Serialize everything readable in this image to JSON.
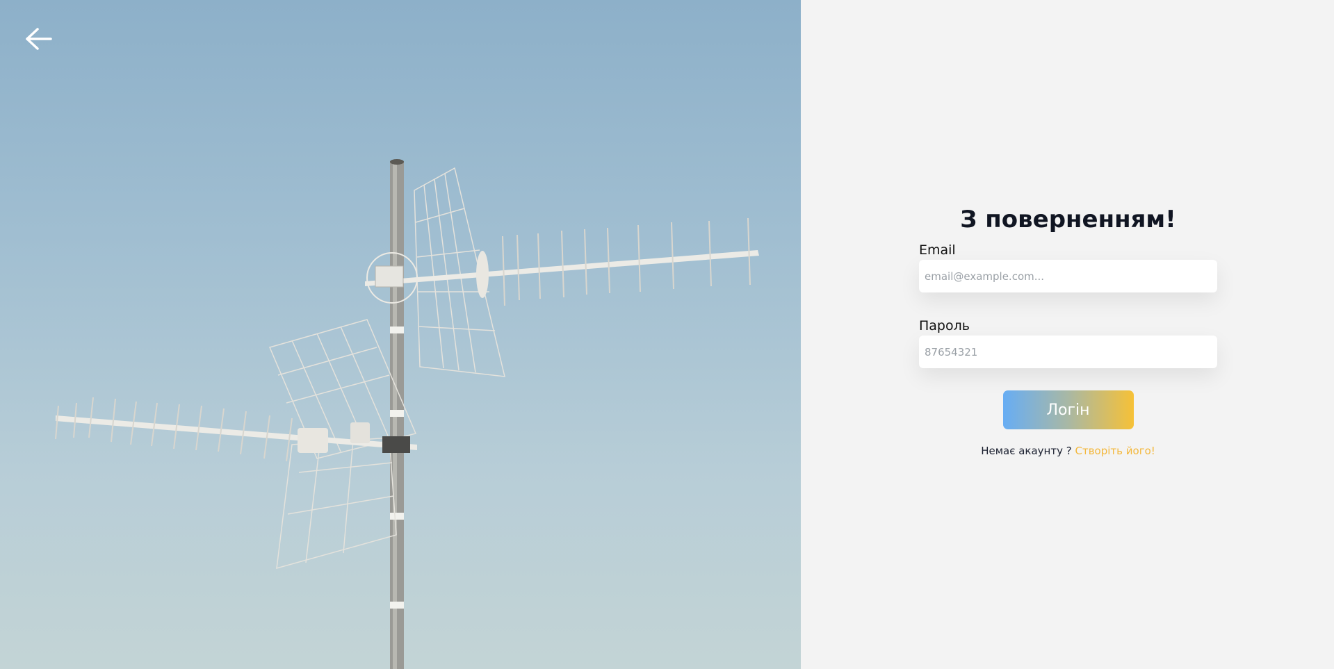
{
  "nav": {
    "back_icon": "arrow-left-icon"
  },
  "hero": {
    "image_subject": "antenna-photo"
  },
  "form": {
    "title": "З поверненням!",
    "email_label": "Email",
    "email_placeholder": "email@example.com...",
    "password_label": "Пароль",
    "password_placeholder": "87654321",
    "submit_label": "Логін",
    "signup_prompt": "Немає акаунту ?",
    "signup_link": "Створіть його!"
  },
  "colors": {
    "link": "#f3b73a",
    "button_gradient_start": "#67adf4",
    "button_gradient_end": "#f6c137",
    "title": "#101522",
    "panel_bg": "#f3f3f3"
  }
}
